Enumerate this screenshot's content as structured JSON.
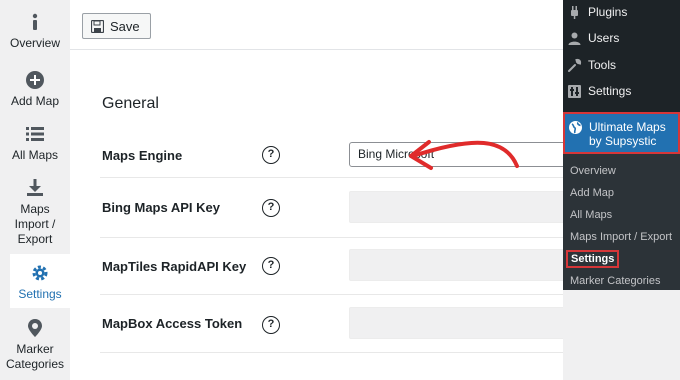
{
  "left_nav": {
    "items": [
      {
        "label": "Overview",
        "icon": "info-icon"
      },
      {
        "label": "Add Map",
        "icon": "plus-circle-icon"
      },
      {
        "label": "All Maps",
        "icon": "list-icon"
      },
      {
        "label": "Maps Import / Export",
        "label_lines": [
          "Maps",
          "Import /",
          "Export"
        ],
        "icon": "download-icon"
      },
      {
        "label": "Settings",
        "icon": "gear-icon",
        "active": true
      },
      {
        "label": "Marker Categories",
        "label_lines": [
          "Marker",
          "Categories"
        ],
        "icon": "map-pin-icon"
      }
    ]
  },
  "toolbar": {
    "save_label": "Save"
  },
  "settings": {
    "section_title": "General",
    "rows": [
      {
        "label": "Maps Engine",
        "help": "?",
        "type": "select",
        "value": "Bing Microsoft"
      },
      {
        "label": "Bing Maps API Key",
        "help": "?",
        "type": "input",
        "value": ""
      },
      {
        "label": "MapTiles RapidAPI Key",
        "help": "?",
        "type": "input",
        "value": ""
      },
      {
        "label": "MapBox Access Token",
        "help": "?",
        "type": "input",
        "value": ""
      }
    ]
  },
  "admin_menu": {
    "items": [
      {
        "label": "Plugins",
        "icon": "plug-icon"
      },
      {
        "label": "Users",
        "icon": "user-icon"
      },
      {
        "label": "Tools",
        "icon": "wrench-icon"
      },
      {
        "label": "Settings",
        "icon": "settings-icon"
      }
    ],
    "active": {
      "label": "Ultimate Maps by Supsystic",
      "icon": "globe-icon"
    },
    "submenu": [
      {
        "label": "Overview"
      },
      {
        "label": "Add Map"
      },
      {
        "label": "All Maps"
      },
      {
        "label": "Maps Import / Export"
      },
      {
        "label": "Settings",
        "current": true
      },
      {
        "label": "Marker Categories"
      }
    ]
  },
  "colors": {
    "accent": "#2271b1",
    "highlight": "#d63638",
    "admin_bg": "#1d2327",
    "arrow": "#e02b2b"
  }
}
